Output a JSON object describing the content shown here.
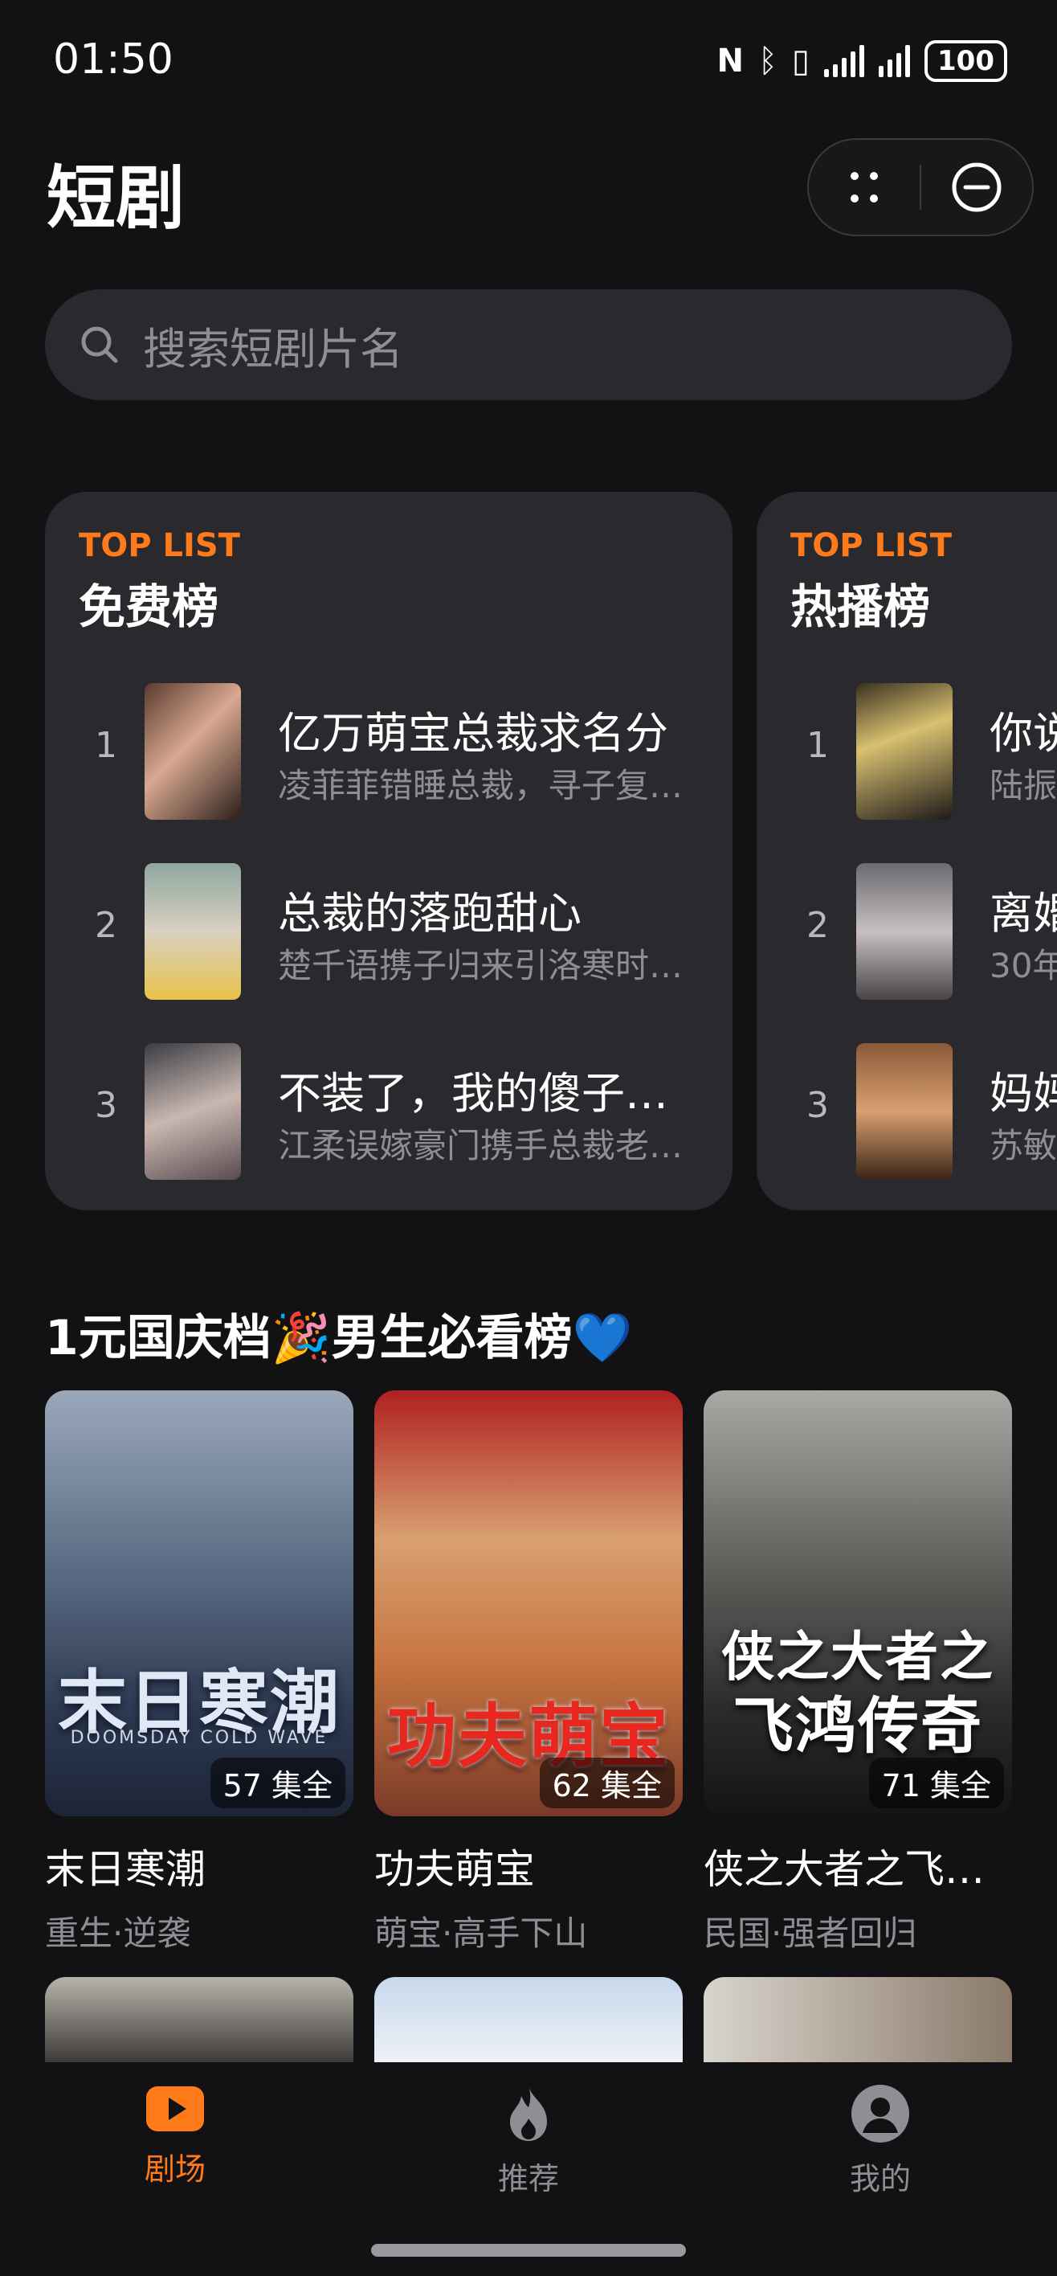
{
  "status_bar": {
    "time": "01:50",
    "battery": "100"
  },
  "header": {
    "title": "短剧"
  },
  "search": {
    "placeholder": "搜索短剧片名"
  },
  "rank_lists": [
    {
      "tag": "TOP LIST",
      "title": "免费榜",
      "items": [
        {
          "rank": "1",
          "name": "亿万萌宝总裁求名分",
          "desc": "凌菲菲错睡总裁，寻子复…"
        },
        {
          "rank": "2",
          "name": "总裁的落跑甜心",
          "desc": "楚千语携子归来引洛寒时…"
        },
        {
          "rank": "3",
          "name": "不装了，我的傻子…",
          "desc": "江柔误嫁豪门携手总裁老…"
        }
      ]
    },
    {
      "tag": "TOP LIST",
      "title": "热播榜",
      "items": [
        {
          "rank": "1",
          "name": "你说",
          "desc": "陆振"
        },
        {
          "rank": "2",
          "name": "离婚",
          "desc": "30年"
        },
        {
          "rank": "3",
          "name": "妈妈",
          "desc": "苏敏"
        }
      ]
    }
  ],
  "section": {
    "title": "1元国庆档🎉男生必看榜💙",
    "cards": [
      {
        "name": "末日寒潮",
        "tags": "重生·逆袭",
        "episodes": "57 集全",
        "cover_text": "末日寒潮",
        "cover_sub": "DOOMSDAY COLD WAVE"
      },
      {
        "name": "功夫萌宝",
        "tags": "萌宝·高手下山",
        "episodes": "62 集全",
        "cover_text": "功夫萌宝"
      },
      {
        "name": "侠之大者之飞…",
        "tags": "民国·强者回归",
        "episodes": "71 集全",
        "cover_text": "侠之大者之",
        "cover_text2": "飞鸿传奇"
      }
    ]
  },
  "bottom_nav": [
    {
      "label": "剧场",
      "icon": "play-icon",
      "active": true
    },
    {
      "label": "推荐",
      "icon": "flame-icon",
      "active": false
    },
    {
      "label": "我的",
      "icon": "user-icon",
      "active": false
    }
  ],
  "colors": {
    "accent": "#ff7a1a",
    "background": "#121214",
    "card": "#2a2a2e"
  }
}
